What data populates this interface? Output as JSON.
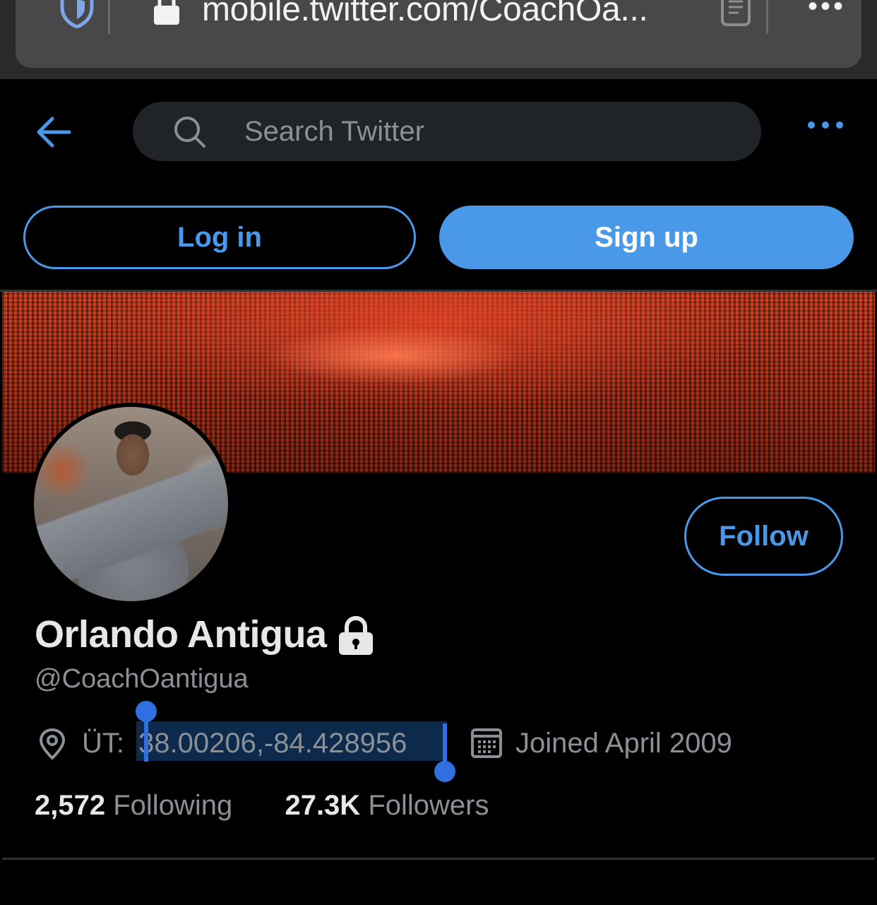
{
  "browser": {
    "url": "mobile.twitter.com/CoachOa...",
    "more_label": "•••"
  },
  "header": {
    "search_placeholder": "Search Twitter"
  },
  "auth": {
    "login_label": "Log in",
    "signup_label": "Sign up"
  },
  "profile": {
    "display_name": "Orlando Antigua",
    "handle": "@CoachOantigua",
    "follow_label": "Follow",
    "location_prefix": "ÜT: ",
    "location_coords": "38.00206,-84.428956",
    "joined": "Joined April 2009",
    "following_count": "2,572",
    "following_label": "Following",
    "followers_count": "27.3K",
    "followers_label": "Followers"
  },
  "colors": {
    "accent": "#4a99e9",
    "background": "#000000",
    "secondary_text": "#8b9096",
    "selection": "#0d2a4d"
  }
}
